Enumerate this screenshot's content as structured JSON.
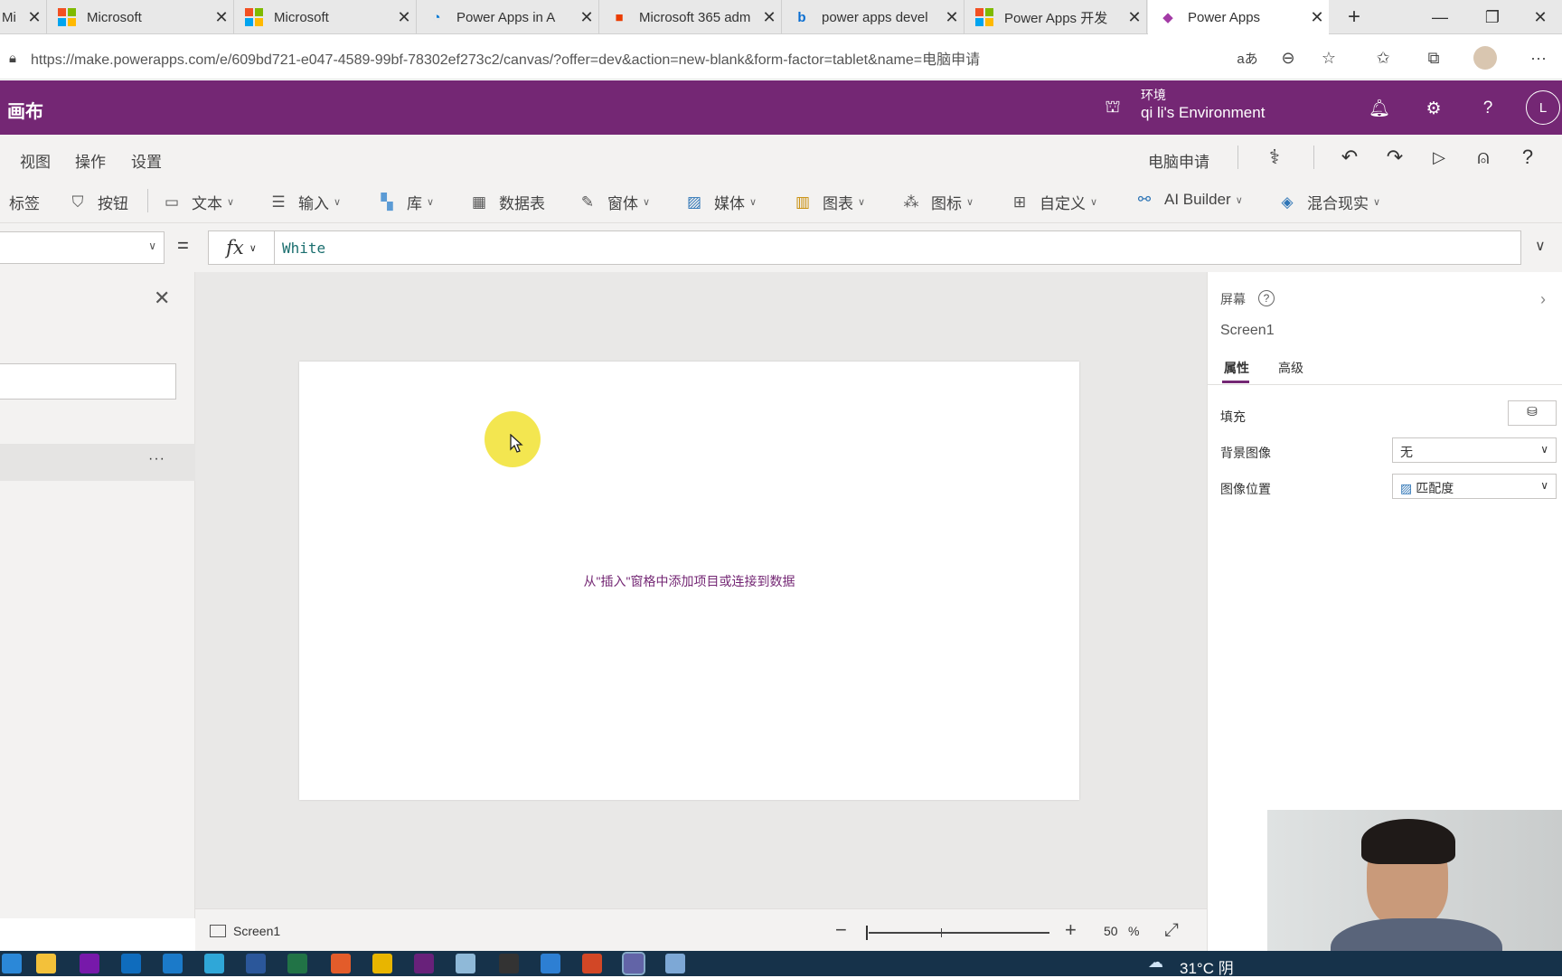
{
  "browser": {
    "tabs": [
      {
        "label": "Mi",
        "icon": "microsoft-icon"
      },
      {
        "label": "Microsoft",
        "icon": "microsoft-icon"
      },
      {
        "label": "Microsoft",
        "icon": "microsoft-icon"
      },
      {
        "label": "Power Apps in A",
        "icon": "azure-icon"
      },
      {
        "label": "Microsoft 365 adm",
        "icon": "office-icon"
      },
      {
        "label": "power apps devel",
        "icon": "bing-icon"
      },
      {
        "label": "Power Apps 开发",
        "icon": "microsoft-icon"
      },
      {
        "label": "Power Apps",
        "icon": "power-apps-icon"
      }
    ],
    "new_tab": "+",
    "url": "https://make.powerapps.com/e/609bd721-e047-4589-99bf-78302ef273c2/canvas/?offer=dev&action=new-blank&form-factor=tablet&name=电脑申请"
  },
  "app_header": {
    "title": "画布",
    "env_label": "环境",
    "env_name": "qi li's Environment",
    "avatar": "L"
  },
  "menu": {
    "items": [
      "视图",
      "操作",
      "设置"
    ],
    "app_name": "电脑申请"
  },
  "insert_toolbar": {
    "items": [
      {
        "label": "标签",
        "dropdown": false
      },
      {
        "label": "按钮",
        "dropdown": false
      },
      {
        "label": "文本",
        "dropdown": true
      },
      {
        "label": "输入",
        "dropdown": true
      },
      {
        "label": "库",
        "dropdown": true
      },
      {
        "label": "数据表",
        "dropdown": false
      },
      {
        "label": "窗体",
        "dropdown": true
      },
      {
        "label": "媒体",
        "dropdown": true
      },
      {
        "label": "图表",
        "dropdown": true
      },
      {
        "label": "图标",
        "dropdown": true
      },
      {
        "label": "自定义",
        "dropdown": true
      },
      {
        "label": "AI Builder",
        "dropdown": true
      },
      {
        "label": "混合现实",
        "dropdown": true
      }
    ]
  },
  "formula_bar": {
    "equals": "=",
    "fx": "fx",
    "value": "White"
  },
  "left_pane": {
    "more": "···"
  },
  "canvas": {
    "hint": "从\"插入\"窗格中添加项目或连接到数据"
  },
  "status_bar": {
    "screen_name": "Screen1",
    "zoom_minus": "−",
    "zoom_plus": "+",
    "zoom_value": "50",
    "zoom_unit": "%",
    "zoom_level": 0.5
  },
  "right_pane": {
    "section": "屏幕",
    "screen_name": "Screen1",
    "tabs": [
      "属性",
      "高级"
    ],
    "fill_label": "填充",
    "bg_image_label": "背景图像",
    "bg_image_value": "无",
    "image_position_label": "图像位置",
    "image_position_value": "匹配度"
  },
  "taskbar": {
    "weather": "31°C 阴"
  },
  "colors": {
    "brand": "#742774",
    "taskbar": "#16324a"
  }
}
